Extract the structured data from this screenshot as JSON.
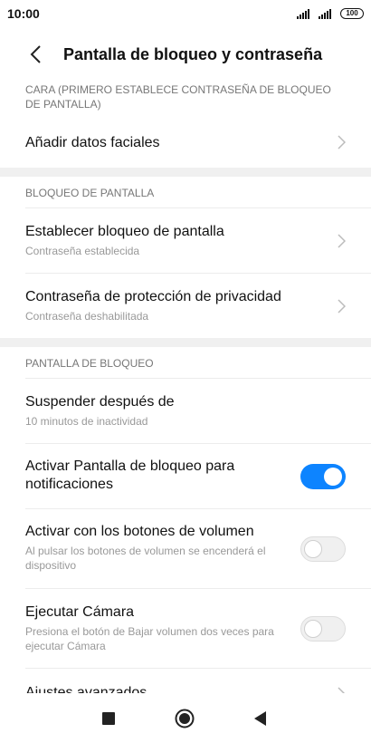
{
  "status_bar": {
    "time": "10:00",
    "battery": "100"
  },
  "header": {
    "title": "Pantalla de bloqueo y contraseña"
  },
  "sections": {
    "face": {
      "header": "CARA (PRIMERO ESTABLECE CONTRASEÑA DE BLOQUEO DE PANTALLA)",
      "add_face_title": "Añadir datos faciales"
    },
    "lock": {
      "header": "BLOQUEO DE PANTALLA",
      "set_lock_title": "Establecer bloqueo de pantalla",
      "set_lock_sub": "Contraseña establecida",
      "privacy_title": "Contraseña de protección de privacidad",
      "privacy_sub": "Contraseña deshabilitada"
    },
    "lockscreen": {
      "header": "PANTALLA DE BLOQUEO",
      "sleep_title": "Suspender después de",
      "sleep_sub": "10 minutos de inactividad",
      "notif_title": "Activar Pantalla de bloqueo para notificaciones",
      "notif_on": true,
      "volume_title": "Activar con los botones de volumen",
      "volume_sub": "Al pulsar los botones de volumen se encenderá el dispositivo",
      "volume_on": false,
      "camera_title": "Ejecutar Cámara",
      "camera_sub": "Presiona el botón de Bajar volumen dos veces para ejecutar Cámara",
      "camera_on": false,
      "advanced_title": "Ajustes avanzados"
    }
  },
  "colors": {
    "accent": "#0d84ff"
  },
  "icons": {
    "back": "chevron-left-icon",
    "chevron": "chevron-right-icon",
    "nav_recents": "square-icon",
    "nav_home": "circle-icon",
    "nav_back": "triangle-left-icon"
  }
}
